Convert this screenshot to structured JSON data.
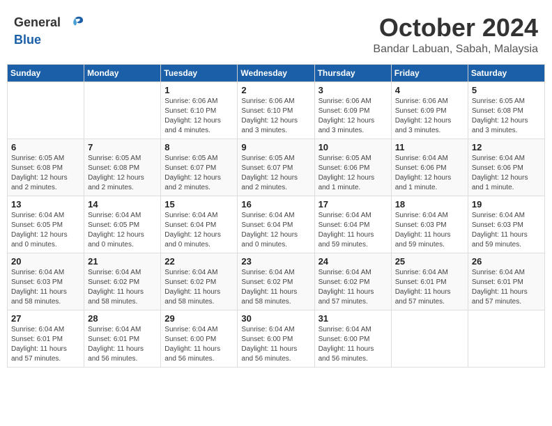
{
  "header": {
    "logo_general": "General",
    "logo_blue": "Blue",
    "month": "October 2024",
    "location": "Bandar Labuan, Sabah, Malaysia"
  },
  "weekdays": [
    "Sunday",
    "Monday",
    "Tuesday",
    "Wednesday",
    "Thursday",
    "Friday",
    "Saturday"
  ],
  "weeks": [
    [
      {
        "day": "",
        "info": ""
      },
      {
        "day": "",
        "info": ""
      },
      {
        "day": "1",
        "info": "Sunrise: 6:06 AM\nSunset: 6:10 PM\nDaylight: 12 hours and 4 minutes."
      },
      {
        "day": "2",
        "info": "Sunrise: 6:06 AM\nSunset: 6:10 PM\nDaylight: 12 hours and 3 minutes."
      },
      {
        "day": "3",
        "info": "Sunrise: 6:06 AM\nSunset: 6:09 PM\nDaylight: 12 hours and 3 minutes."
      },
      {
        "day": "4",
        "info": "Sunrise: 6:06 AM\nSunset: 6:09 PM\nDaylight: 12 hours and 3 minutes."
      },
      {
        "day": "5",
        "info": "Sunrise: 6:05 AM\nSunset: 6:08 PM\nDaylight: 12 hours and 3 minutes."
      }
    ],
    [
      {
        "day": "6",
        "info": "Sunrise: 6:05 AM\nSunset: 6:08 PM\nDaylight: 12 hours and 2 minutes."
      },
      {
        "day": "7",
        "info": "Sunrise: 6:05 AM\nSunset: 6:08 PM\nDaylight: 12 hours and 2 minutes."
      },
      {
        "day": "8",
        "info": "Sunrise: 6:05 AM\nSunset: 6:07 PM\nDaylight: 12 hours and 2 minutes."
      },
      {
        "day": "9",
        "info": "Sunrise: 6:05 AM\nSunset: 6:07 PM\nDaylight: 12 hours and 2 minutes."
      },
      {
        "day": "10",
        "info": "Sunrise: 6:05 AM\nSunset: 6:06 PM\nDaylight: 12 hours and 1 minute."
      },
      {
        "day": "11",
        "info": "Sunrise: 6:04 AM\nSunset: 6:06 PM\nDaylight: 12 hours and 1 minute."
      },
      {
        "day": "12",
        "info": "Sunrise: 6:04 AM\nSunset: 6:06 PM\nDaylight: 12 hours and 1 minute."
      }
    ],
    [
      {
        "day": "13",
        "info": "Sunrise: 6:04 AM\nSunset: 6:05 PM\nDaylight: 12 hours and 0 minutes."
      },
      {
        "day": "14",
        "info": "Sunrise: 6:04 AM\nSunset: 6:05 PM\nDaylight: 12 hours and 0 minutes."
      },
      {
        "day": "15",
        "info": "Sunrise: 6:04 AM\nSunset: 6:04 PM\nDaylight: 12 hours and 0 minutes."
      },
      {
        "day": "16",
        "info": "Sunrise: 6:04 AM\nSunset: 6:04 PM\nDaylight: 12 hours and 0 minutes."
      },
      {
        "day": "17",
        "info": "Sunrise: 6:04 AM\nSunset: 6:04 PM\nDaylight: 11 hours and 59 minutes."
      },
      {
        "day": "18",
        "info": "Sunrise: 6:04 AM\nSunset: 6:03 PM\nDaylight: 11 hours and 59 minutes."
      },
      {
        "day": "19",
        "info": "Sunrise: 6:04 AM\nSunset: 6:03 PM\nDaylight: 11 hours and 59 minutes."
      }
    ],
    [
      {
        "day": "20",
        "info": "Sunrise: 6:04 AM\nSunset: 6:03 PM\nDaylight: 11 hours and 58 minutes."
      },
      {
        "day": "21",
        "info": "Sunrise: 6:04 AM\nSunset: 6:02 PM\nDaylight: 11 hours and 58 minutes."
      },
      {
        "day": "22",
        "info": "Sunrise: 6:04 AM\nSunset: 6:02 PM\nDaylight: 11 hours and 58 minutes."
      },
      {
        "day": "23",
        "info": "Sunrise: 6:04 AM\nSunset: 6:02 PM\nDaylight: 11 hours and 58 minutes."
      },
      {
        "day": "24",
        "info": "Sunrise: 6:04 AM\nSunset: 6:02 PM\nDaylight: 11 hours and 57 minutes."
      },
      {
        "day": "25",
        "info": "Sunrise: 6:04 AM\nSunset: 6:01 PM\nDaylight: 11 hours and 57 minutes."
      },
      {
        "day": "26",
        "info": "Sunrise: 6:04 AM\nSunset: 6:01 PM\nDaylight: 11 hours and 57 minutes."
      }
    ],
    [
      {
        "day": "27",
        "info": "Sunrise: 6:04 AM\nSunset: 6:01 PM\nDaylight: 11 hours and 57 minutes."
      },
      {
        "day": "28",
        "info": "Sunrise: 6:04 AM\nSunset: 6:01 PM\nDaylight: 11 hours and 56 minutes."
      },
      {
        "day": "29",
        "info": "Sunrise: 6:04 AM\nSunset: 6:00 PM\nDaylight: 11 hours and 56 minutes."
      },
      {
        "day": "30",
        "info": "Sunrise: 6:04 AM\nSunset: 6:00 PM\nDaylight: 11 hours and 56 minutes."
      },
      {
        "day": "31",
        "info": "Sunrise: 6:04 AM\nSunset: 6:00 PM\nDaylight: 11 hours and 56 minutes."
      },
      {
        "day": "",
        "info": ""
      },
      {
        "day": "",
        "info": ""
      }
    ]
  ]
}
